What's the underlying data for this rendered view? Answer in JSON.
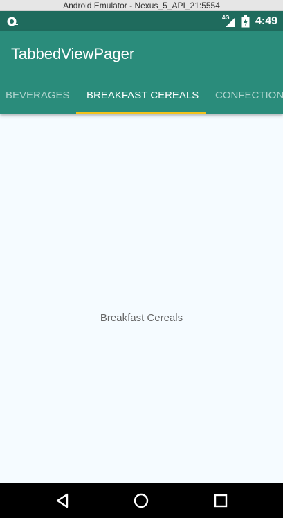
{
  "window": {
    "title": "Android Emulator - Nexus_5_API_21:5554"
  },
  "status_bar": {
    "network_type": "4G",
    "time": "4:49",
    "icons": [
      "notification-icon",
      "signal-icon",
      "battery-icon"
    ]
  },
  "app_bar": {
    "title": "TabbedViewPager"
  },
  "tabs": [
    {
      "label": "BEVERAGES",
      "selected": false
    },
    {
      "label": "BREAKFAST CEREALS",
      "selected": true
    },
    {
      "label": "CONFECTIONS",
      "selected": false
    }
  ],
  "page": {
    "label": "Breakfast Cereals"
  },
  "nav_bar": {
    "icons": [
      "back-icon",
      "home-icon",
      "recents-icon"
    ]
  },
  "colors": {
    "status_bar": "#1f6b5d",
    "app_bar": "#2a8c7b",
    "tab_indicator": "#f2c21b",
    "content_background": "#f5fbff",
    "nav_bar": "#000000"
  }
}
